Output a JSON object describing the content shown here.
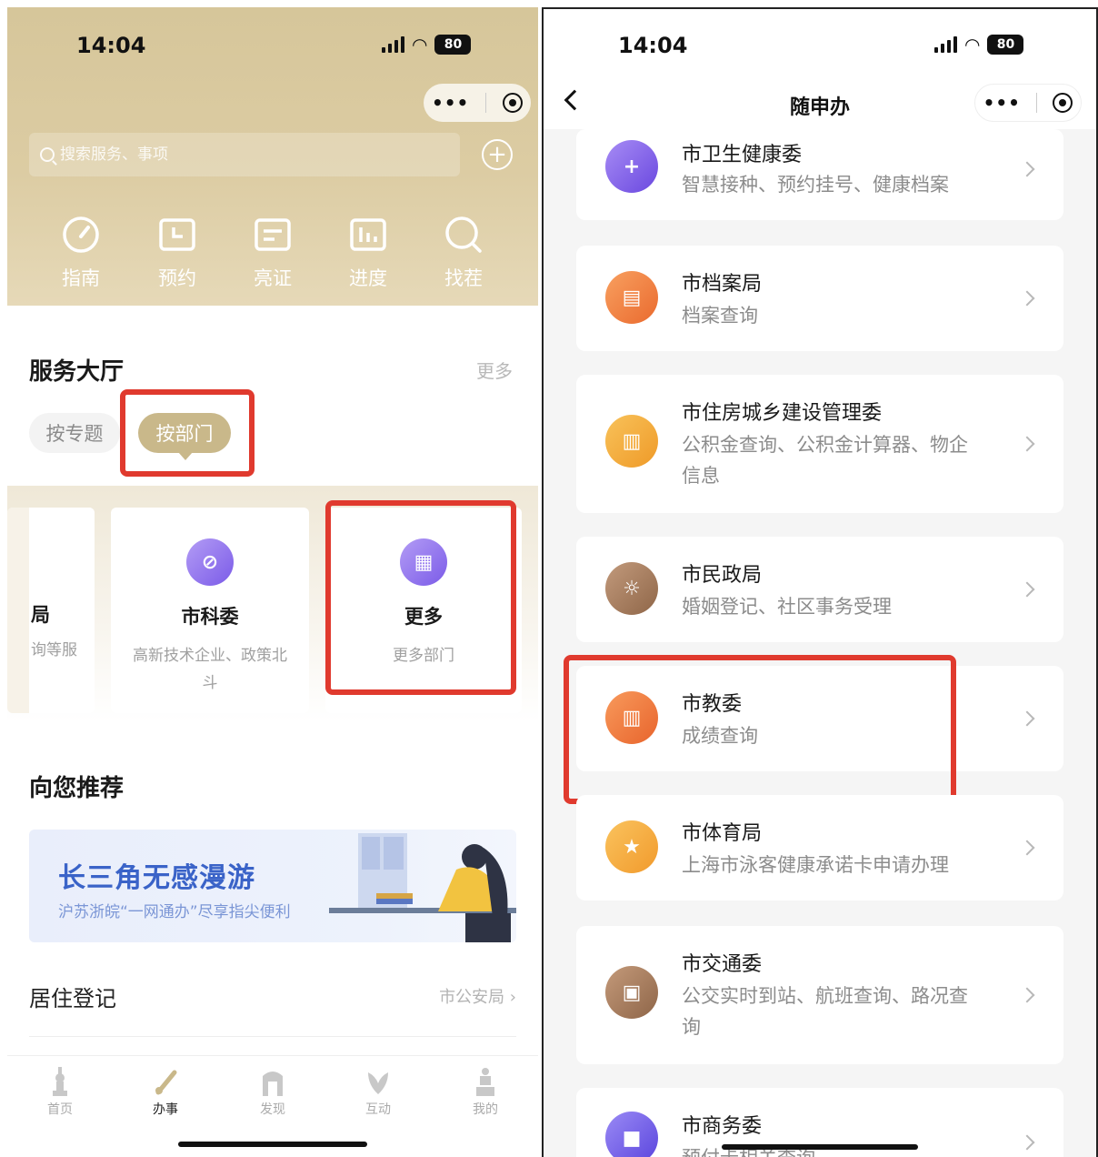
{
  "left": {
    "status": {
      "time": "14:04",
      "battery": "80"
    },
    "search": {
      "placeholder": "搜索服务、事项"
    },
    "quick_actions": [
      {
        "label": "指南",
        "icon": "gauge-icon"
      },
      {
        "label": "预约",
        "icon": "calendar-icon"
      },
      {
        "label": "亮证",
        "icon": "card-icon"
      },
      {
        "label": "进度",
        "icon": "bar-chart-icon"
      },
      {
        "label": "找茬",
        "icon": "search-icon"
      }
    ],
    "service_hall": {
      "title": "服务大厅",
      "more": "更多",
      "tabs": [
        "按专题",
        "按部门"
      ],
      "active_tab": "按部门"
    },
    "dept_cards": [
      {
        "name": "局",
        "desc": "询等服"
      },
      {
        "name": "市科委",
        "desc": "高新技术企业、政策北斗"
      },
      {
        "name": "更多",
        "desc": "更多部门"
      }
    ],
    "recommend": {
      "title": "向您推荐",
      "banner_title": "长三角无感漫游",
      "banner_sub": "沪苏浙皖“一网通办”尽享指尖便利"
    },
    "residence": {
      "title": "居住登记",
      "source": "市公安局"
    },
    "tabbar": [
      {
        "label": "首页"
      },
      {
        "label": "办事"
      },
      {
        "label": "发现"
      },
      {
        "label": "互动"
      },
      {
        "label": "我的"
      }
    ],
    "accent_color": "#c9b88a",
    "highlight_color": "#e03a2e"
  },
  "right": {
    "status": {
      "time": "14:04",
      "battery": "80"
    },
    "nav_title": "随申办",
    "departments": [
      {
        "name": "市卫生健康委",
        "desc": "智慧接种、预约挂号、健康档案",
        "icon_color": "#7a5ae6"
      },
      {
        "name": "市档案局",
        "desc": "档案查询",
        "icon_color": "#f07a3c"
      },
      {
        "name": "市住房城乡建设管理委",
        "desc": "公积金查询、公积金计算器、物企信息",
        "icon_color": "#f3a43a"
      },
      {
        "name": "市民政局",
        "desc": "婚姻登记、社区事务受理",
        "icon_color": "#a2785c"
      },
      {
        "name": "市教委",
        "desc": "成绩查询",
        "icon_color": "#f0763a"
      },
      {
        "name": "市体育局",
        "desc": "上海市泳客健康承诺卡申请办理",
        "icon_color": "#f6a93b"
      },
      {
        "name": "市交通委",
        "desc": "公交实时到站、航班查询、路况查询",
        "icon_color": "#a8785a"
      },
      {
        "name": "市商务委",
        "desc": "预付卡相关查询",
        "icon_color": "#6b58e2"
      }
    ]
  }
}
